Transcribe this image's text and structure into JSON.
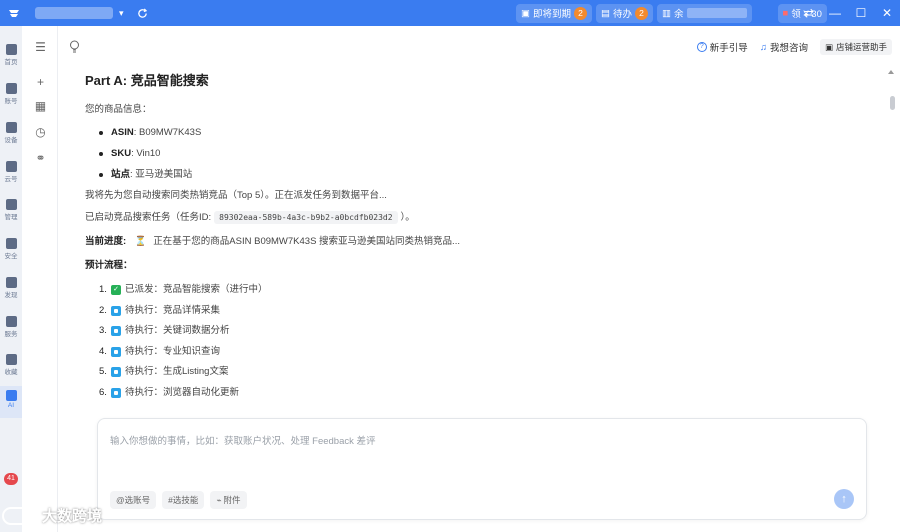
{
  "topbar": {
    "account_flag": "▾",
    "pills": [
      {
        "label": "即将到期",
        "count": "2"
      },
      {
        "label": "待办",
        "count": "2"
      },
      {
        "label": "余"
      }
    ],
    "wallet": "领 ¥ 30",
    "window": {
      "min": "—",
      "max": "☐",
      "close": "✕"
    }
  },
  "leftnav": {
    "items": [
      {
        "label": "首页",
        "icon": "home-icon"
      },
      {
        "label": "账号",
        "icon": "account-icon"
      },
      {
        "label": "设备",
        "icon": "device-icon"
      },
      {
        "label": "云号",
        "icon": "cloud-icon"
      },
      {
        "label": "管理",
        "icon": "manage-icon"
      },
      {
        "label": "安全",
        "icon": "security-icon"
      },
      {
        "label": "发现",
        "icon": "discover-icon"
      },
      {
        "label": "服务",
        "icon": "service-icon"
      },
      {
        "label": "收藏",
        "icon": "star-icon"
      },
      {
        "label": "AI",
        "icon": "ai-icon"
      }
    ],
    "notif_count": "41"
  },
  "header": {
    "guide_label": "新手引导",
    "consult_label": "我想咨询",
    "store_label": "店铺运营助手"
  },
  "content": {
    "title": "Part A: 竞品智能搜索",
    "intro": "您的商品信息：",
    "info": [
      {
        "key": "ASIN",
        "value": ": B09MW7K43S"
      },
      {
        "key": "SKU",
        "value": ": Vin10"
      },
      {
        "key": "站点",
        "value": ": 亚马逊美国站"
      }
    ],
    "line1": "我将先为您自动搜索同类热销竞品（Top 5）。正在派发任务到数据平台...",
    "line2_prefix": "已启动竞品搜索任务（任务ID:",
    "task_id": "89302eaa-589b-4a3c-b9b2-a0bcdfb023d2",
    "line2_suffix": "）。",
    "progress_label": "当前进度:",
    "progress_icon": "⏳",
    "progress_text": "正在基于您的商品ASIN B09MW7K43S 搜索亚马逊美国站同类热销竞品...",
    "flow_label": "预计流程：",
    "steps": [
      {
        "num": "1.",
        "status": "done",
        "text": "已派发：竞品智能搜索（进行中）"
      },
      {
        "num": "2.",
        "status": "pending",
        "text": "待执行：竞品详情采集"
      },
      {
        "num": "3.",
        "status": "pending",
        "text": "待执行：关键词数据分析"
      },
      {
        "num": "4.",
        "status": "pending",
        "text": "待执行：专业知识查询"
      },
      {
        "num": "5.",
        "status": "pending",
        "text": "待执行：生成Listing文案"
      },
      {
        "num": "6.",
        "status": "pending",
        "text": "待执行：浏览器自动化更新"
      }
    ]
  },
  "input": {
    "placeholder": "输入你想做的事情，比如：获取账户状况、处理 Feedback 差评",
    "chips": [
      "@选账号",
      "#选技能",
      "附件"
    ]
  },
  "brand": "大数跨境"
}
